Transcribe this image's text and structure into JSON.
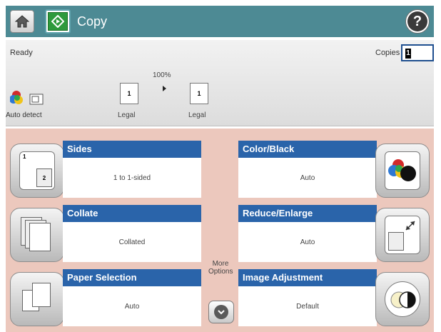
{
  "header": {
    "title": "Copy",
    "accent": "#4d8a94",
    "home_icon": "home-icon",
    "copy_icon": "copy-start-icon",
    "help_icon": "help-icon",
    "help_glyph": "?"
  },
  "status": {
    "ready": "Ready",
    "copies_label": "Copies :",
    "copies_value": "1",
    "zoom": "100%",
    "original_page": "1",
    "original_size": "Legal",
    "output_page": "1",
    "output_size": "Legal",
    "auto_detect": "Auto detect"
  },
  "tiles": {
    "sides": {
      "title": "Sides",
      "value": "1 to 1-sided"
    },
    "color_black": {
      "title": "Color/Black",
      "value": "Auto"
    },
    "collate": {
      "title": "Collate",
      "value": "Collated"
    },
    "reduce_enlarge": {
      "title": "Reduce/Enlarge",
      "value": "Auto"
    },
    "paper_selection": {
      "title": "Paper Selection",
      "value": "Auto"
    },
    "image_adjustment": {
      "title": "Image Adjustment",
      "value": "Default"
    }
  },
  "more_options": "More Options",
  "colors": {
    "tile_title": "#2a64aa",
    "main_bg": "#ecc8bd"
  }
}
